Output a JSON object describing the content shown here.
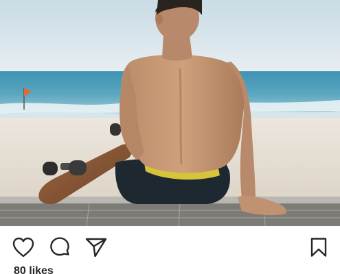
{
  "post": {
    "image_description_icon": "photo",
    "actions": {
      "like_icon": "heart-icon",
      "comment_icon": "comment-icon",
      "share_icon": "send-icon",
      "save_icon": "bookmark-icon"
    },
    "likes_label": "80 likes"
  },
  "colors": {
    "icon": "#262626",
    "text": "#262626",
    "background": "#ffffff"
  }
}
